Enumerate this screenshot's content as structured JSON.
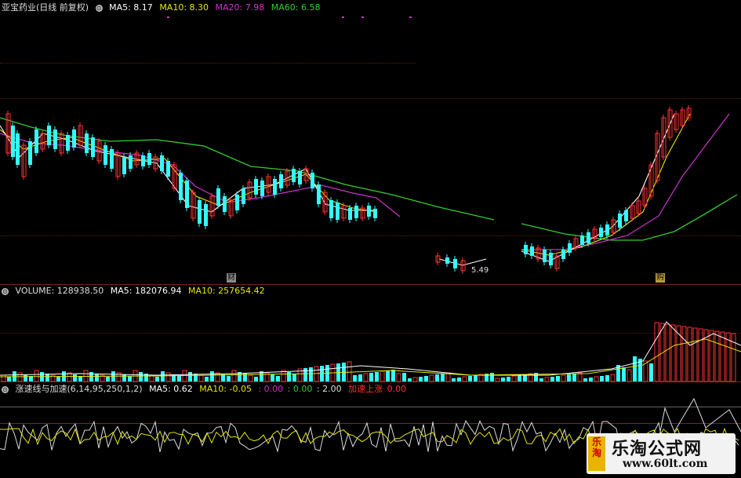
{
  "top_panel": {
    "stock_name": "亚宝药业",
    "mode": "(日线 前复权)",
    "ma": [
      {
        "label": "MA5: 8.17",
        "color": "#ffffff"
      },
      {
        "label": "MA10: 8.30",
        "color": "#e6e600"
      },
      {
        "label": "MA20: 7.98",
        "color": "#cc33cc"
      },
      {
        "label": "MA60: 6.58",
        "color": "#33cc33"
      }
    ],
    "low_label": "5.49",
    "event_tag_1": "财",
    "event_tag_2": "购"
  },
  "volume_panel": {
    "title": "VOLUME: 128938.50",
    "ma5": "MA5: 182076.94",
    "ma10": "MA10: 257654.42"
  },
  "indicator_panel": {
    "title": "涨速线与加速(6,14,95,250,1,2)",
    "ma5": "MA5: 0.62",
    "ma10": "MA10: -0.05",
    "v1": ": 0.00",
    "v2": ": 0.00",
    "v3": ": 2.00",
    "signal": "加速上涨",
    "signal_value": "0.00"
  },
  "watermark": {
    "logo": "乐淘",
    "title": "乐淘公式网",
    "url": "www.60lt.com"
  },
  "colors": {
    "up": "#ff3333",
    "down": "#33ffff",
    "ma5": "#ffffff",
    "ma10": "#e6e600",
    "ma20": "#cc33cc",
    "ma60": "#33cc33",
    "separator": "#7a1f1f"
  }
}
